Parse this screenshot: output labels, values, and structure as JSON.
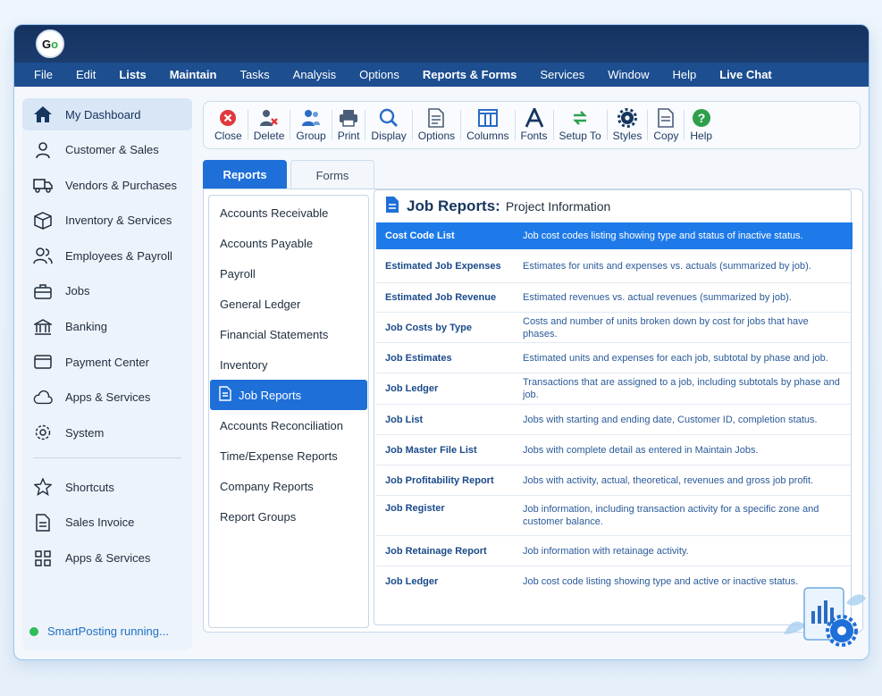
{
  "app": {
    "logo_text": "Go"
  },
  "menu": [
    "File",
    "Edit",
    "Lists",
    "Maintain",
    "Tasks",
    "Analysis",
    "Options",
    "Reports & Forms",
    "Services",
    "Window",
    "Help",
    "Live Chat"
  ],
  "sidebar": {
    "items": [
      {
        "label": "My Dashboard",
        "icon": "home-icon"
      },
      {
        "label": "Customer & Sales",
        "icon": "user-icon"
      },
      {
        "label": "Vendors & Purchases",
        "icon": "truck-icon"
      },
      {
        "label": "Inventory & Services",
        "icon": "box-icon"
      },
      {
        "label": "Employees & Payroll",
        "icon": "users-icon"
      },
      {
        "label": "Jobs",
        "icon": "briefcase-icon"
      },
      {
        "label": "Banking",
        "icon": "bank-icon"
      },
      {
        "label": "Payment Center",
        "icon": "card-icon"
      },
      {
        "label": "Apps & Services",
        "icon": "cloud-icon"
      },
      {
        "label": "System",
        "icon": "gear-icon"
      }
    ],
    "shortcuts": [
      {
        "label": "Shortcuts",
        "icon": "star-icon"
      },
      {
        "label": "Sales Invoice",
        "icon": "document-icon"
      },
      {
        "label": "Apps & Services",
        "icon": "grid-icon"
      }
    ],
    "status": "SmartPosting running..."
  },
  "toolbar": [
    {
      "label": "Close",
      "icon": "close-icon"
    },
    {
      "label": "Delete",
      "icon": "delete-user-icon"
    },
    {
      "label": "Group",
      "icon": "group-icon"
    },
    {
      "label": "Print",
      "icon": "printer-icon"
    },
    {
      "label": "Display",
      "icon": "search-icon"
    },
    {
      "label": "Options",
      "icon": "options-icon"
    },
    {
      "label": "Columns",
      "icon": "columns-icon"
    },
    {
      "label": "Fonts",
      "icon": "font-icon"
    },
    {
      "label": "Setup To",
      "icon": "setup-icon"
    },
    {
      "label": "Styles",
      "icon": "styles-gear-icon"
    },
    {
      "label": "Copy",
      "icon": "copy-icon"
    },
    {
      "label": "Help",
      "icon": "help-icon"
    }
  ],
  "tabs": {
    "reports": "Reports",
    "forms": "Forms"
  },
  "categories": [
    "Accounts Receivable",
    "Accounts Payable",
    "Payroll",
    "General Ledger",
    "Financial Statements",
    "Inventory",
    "Job Reports",
    "Accounts Reconciliation",
    "Time/Expense Reports",
    "Company Reports",
    "Report Groups"
  ],
  "selected_category": "Job Reports",
  "report_panel": {
    "title": "Job Reports:",
    "subtitle": "Project Information",
    "rows": [
      {
        "name": "Cost Code List",
        "desc": "Job cost codes listing showing type and status of inactive status."
      },
      {
        "name": "Estimated Job Expenses",
        "desc": "Estimates for units and expenses vs. actuals (summarized by job)."
      },
      {
        "name": "Estimated Job Revenue",
        "desc": "Estimated revenues vs. actual revenues (summarized by job)."
      },
      {
        "name": "Job Costs by Type",
        "desc": "Costs and number of units broken down by cost for jobs that have phases."
      },
      {
        "name": "Job Estimates",
        "desc": "Estimated units and expenses for each job, subtotal by phase and job."
      },
      {
        "name": "Job Ledger",
        "desc": "Transactions that are assigned to a job, including subtotals by phase and job."
      },
      {
        "name": "Job List",
        "desc": "Jobs with starting and ending date, Customer ID, completion status."
      },
      {
        "name": "Job Master File List",
        "desc": "Jobs with complete detail as entered in Maintain Jobs."
      },
      {
        "name": "Job Profitability Report",
        "desc": "Jobs with activity, actual, theoretical, revenues and gross job profit."
      },
      {
        "name": "Job Register",
        "desc": "Job information, including transaction activity for a specific zone and customer balance."
      },
      {
        "name": "Job Retainage Report",
        "desc": "Job information with retainage activity."
      },
      {
        "name": "Job Ledger",
        "desc": "Job cost code listing showing type and active or inactive status."
      }
    ],
    "selected_row": "Cost Code List"
  },
  "colors": {
    "accent": "#1e6fd8",
    "menubar": "#1c4e90",
    "titlebar": "#15325f",
    "status": "#2ebd57"
  }
}
